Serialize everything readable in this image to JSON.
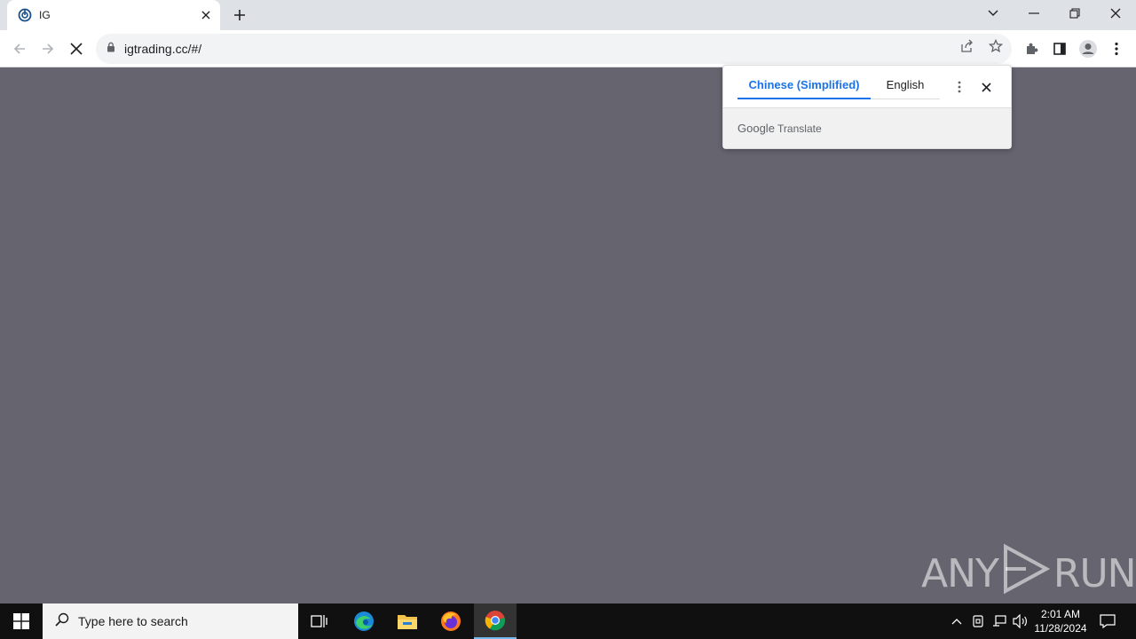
{
  "tab": {
    "title": "IG"
  },
  "omnibox": {
    "url": "igtrading.cc/#/"
  },
  "translate": {
    "tab_source": "Chinese (Simplified)",
    "tab_target": "English",
    "brand_google": "Google",
    "brand_translate": "Translate"
  },
  "watermark": {
    "left": "ANY",
    "right": "RUN"
  },
  "taskbar": {
    "search_placeholder": "Type here to search",
    "time": "2:01 AM",
    "date": "11/28/2024"
  },
  "colors": {
    "page_background": "#66646f",
    "accent": "#1a73e8",
    "taskbar": "#101010"
  }
}
